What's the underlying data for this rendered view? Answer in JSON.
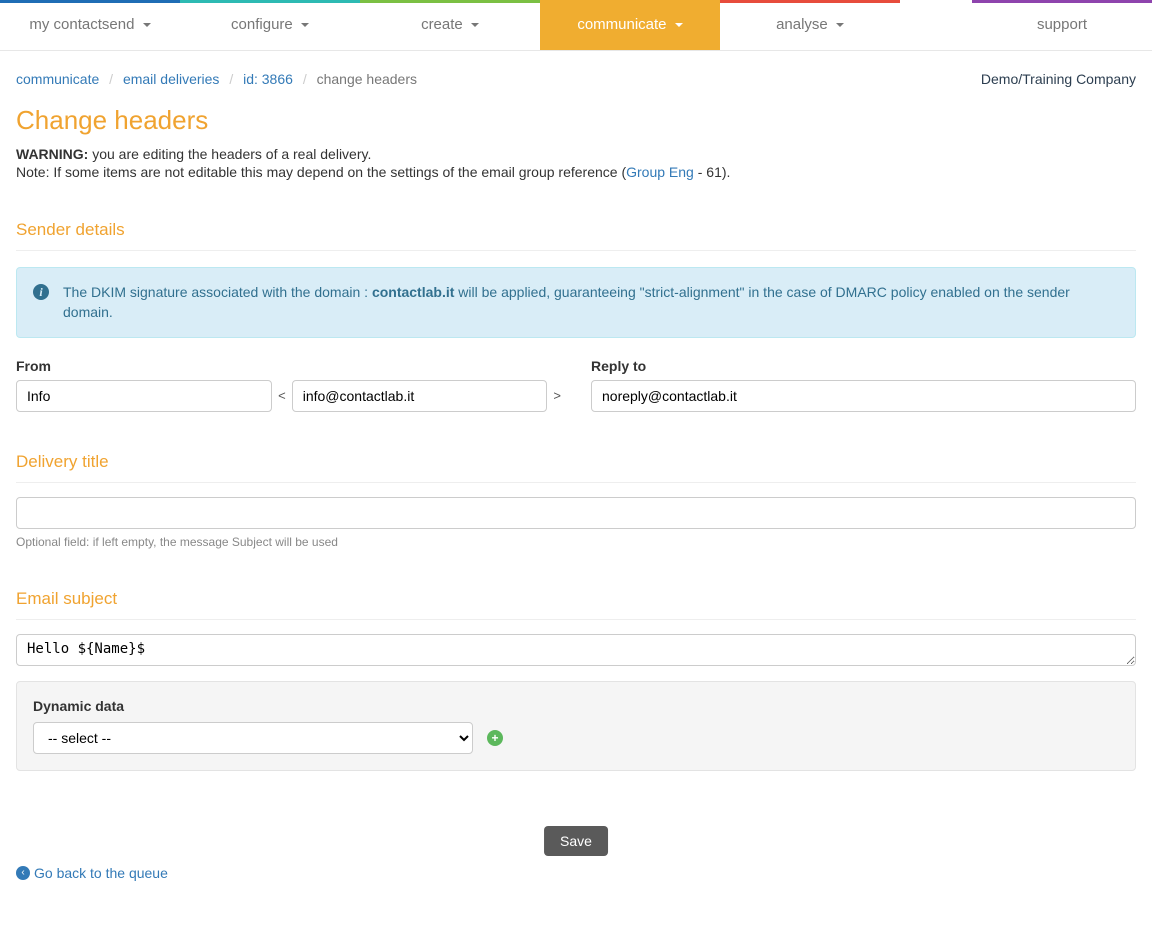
{
  "nav": {
    "tabs": [
      {
        "label": "my contactsend",
        "color": "#1f6db5",
        "caret": true
      },
      {
        "label": "configure",
        "color": "#2dbab3",
        "caret": true
      },
      {
        "label": "create",
        "color": "#7bc043",
        "caret": true
      },
      {
        "label": "communicate",
        "color": "#f0ad30",
        "caret": true,
        "active": true
      },
      {
        "label": "analyse",
        "color": "#e74c3c",
        "caret": true
      }
    ],
    "support": {
      "label": "support",
      "color": "#8e44ad"
    }
  },
  "breadcrumb": {
    "items": [
      {
        "label": "communicate",
        "link": true
      },
      {
        "label": "email deliveries",
        "link": true
      },
      {
        "label": "id: 3866",
        "link": true
      },
      {
        "label": "change headers",
        "link": false
      }
    ],
    "company": "Demo/Training Company"
  },
  "page": {
    "title": "Change headers",
    "warning_label": "WARNING:",
    "warning_text": "you are editing the headers of a real delivery.",
    "note_prefix": "Note: If some items are not editable this may depend on the settings of the email group reference (",
    "group_link": "Group Eng",
    "note_suffix": " - 61)."
  },
  "sender": {
    "section_title": "Sender details",
    "dkim": {
      "pre": "The DKIM signature associated with the domain : ",
      "domain": "contactlab.it",
      "post": " will be applied, guaranteeing \"strict-alignment\" in the case of DMARC policy enabled on the sender domain."
    },
    "from_label": "From",
    "from_name": "Info",
    "from_addr": "info@contactlab.it",
    "reply_label": "Reply to",
    "reply_addr": "noreply@contactlab.it"
  },
  "delivery": {
    "section_title": "Delivery title",
    "value": "",
    "help": "Optional field: if left empty, the message Subject will be used"
  },
  "subject": {
    "section_title": "Email subject",
    "value": "Hello ${Name}$",
    "dyn_label": "Dynamic data",
    "dyn_placeholder": "-- select --"
  },
  "footer": {
    "save": "Save",
    "back": "Go back to the queue"
  }
}
